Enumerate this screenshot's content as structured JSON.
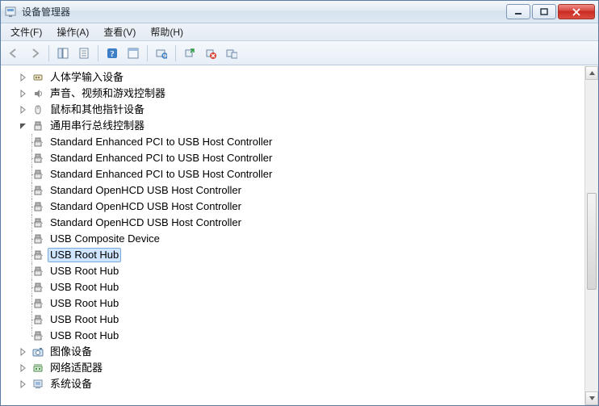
{
  "window": {
    "title": "设备管理器"
  },
  "menu": {
    "file": "文件(F)",
    "action": "操作(A)",
    "view": "查看(V)",
    "help": "帮助(H)"
  },
  "tree": {
    "hid": "人体学输入设备",
    "sound": "声音、视频和游戏控制器",
    "mouse": "鼠标和其他指针设备",
    "usb_root": "通用串行总线控制器",
    "imaging": "图像设备",
    "network": "网络适配器",
    "system": "系统设备",
    "usb_children": [
      "Standard Enhanced PCI to USB Host Controller",
      "Standard Enhanced PCI to USB Host Controller",
      "Standard Enhanced PCI to USB Host Controller",
      "Standard OpenHCD USB Host Controller",
      "Standard OpenHCD USB Host Controller",
      "Standard OpenHCD USB Host Controller",
      "USB Composite Device",
      "USB Root Hub",
      "USB Root Hub",
      "USB Root Hub",
      "USB Root Hub",
      "USB Root Hub",
      "USB Root Hub"
    ],
    "selected_index": 7
  }
}
